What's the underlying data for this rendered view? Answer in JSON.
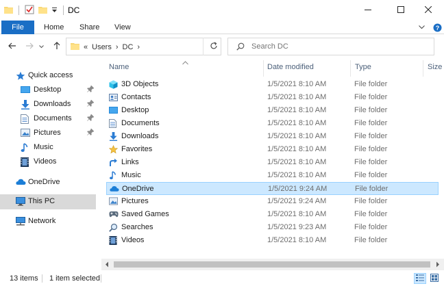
{
  "window": {
    "title": "DC",
    "minimize_icon": "minimize-icon",
    "maximize_icon": "maximize-icon",
    "close_icon": "close-icon"
  },
  "quick_access_toolbar": {
    "icons": [
      "folder-icon",
      "properties-icon",
      "new-folder-icon",
      "customize-dropdown-icon"
    ]
  },
  "ribbon": {
    "tabs": [
      "File",
      "Home",
      "Share",
      "View"
    ],
    "file_tab_color": "#1a6ec5",
    "expand_icon": "chevron-down-icon",
    "help_icon": "help-icon"
  },
  "address_bar": {
    "back_icon": "back-arrow-icon",
    "forward_icon": "forward-arrow-icon",
    "recent_icon": "recent-locations-dropdown-icon",
    "up_icon": "up-arrow-icon",
    "overflow": "«",
    "crumbs": [
      "Users",
      "DC"
    ],
    "separator": "›",
    "dropdown_icon": "chevron-down-icon",
    "refresh_icon": "refresh-icon"
  },
  "search": {
    "placeholder": "Search DC",
    "icon": "search-icon"
  },
  "nav": {
    "quick_access": {
      "label": "Quick access",
      "icon": "star-icon"
    },
    "pinned": [
      {
        "label": "Desktop",
        "icon": "desktop-icon",
        "pinned": true
      },
      {
        "label": "Downloads",
        "icon": "download-icon",
        "pinned": true
      },
      {
        "label": "Documents",
        "icon": "documents-icon",
        "pinned": true
      },
      {
        "label": "Pictures",
        "icon": "pictures-icon",
        "pinned": true
      },
      {
        "label": "Music",
        "icon": "music-icon",
        "pinned": false
      },
      {
        "label": "Videos",
        "icon": "videos-icon",
        "pinned": false
      }
    ],
    "onedrive": {
      "label": "OneDrive",
      "icon": "cloud-icon"
    },
    "this_pc": {
      "label": "This PC",
      "icon": "computer-icon",
      "selected": true
    },
    "network": {
      "label": "Network",
      "icon": "network-icon"
    }
  },
  "columns": {
    "name": "Name",
    "date": "Date modified",
    "type": "Type",
    "size": "Size"
  },
  "files": [
    {
      "name": "3D Objects",
      "date": "1/5/2021 8:10 AM",
      "type": "File folder",
      "icon": "3d-objects-icon"
    },
    {
      "name": "Contacts",
      "date": "1/5/2021 8:10 AM",
      "type": "File folder",
      "icon": "contacts-icon"
    },
    {
      "name": "Desktop",
      "date": "1/5/2021 8:10 AM",
      "type": "File folder",
      "icon": "desktop-icon"
    },
    {
      "name": "Documents",
      "date": "1/5/2021 8:10 AM",
      "type": "File folder",
      "icon": "documents-icon"
    },
    {
      "name": "Downloads",
      "date": "1/5/2021 8:10 AM",
      "type": "File folder",
      "icon": "download-icon"
    },
    {
      "name": "Favorites",
      "date": "1/5/2021 8:10 AM",
      "type": "File folder",
      "icon": "favorites-star-icon"
    },
    {
      "name": "Links",
      "date": "1/5/2021 8:10 AM",
      "type": "File folder",
      "icon": "links-arrow-icon"
    },
    {
      "name": "Music",
      "date": "1/5/2021 8:10 AM",
      "type": "File folder",
      "icon": "music-icon"
    },
    {
      "name": "OneDrive",
      "date": "1/5/2021 9:24 AM",
      "type": "File folder",
      "icon": "cloud-icon",
      "selected": true
    },
    {
      "name": "Pictures",
      "date": "1/5/2021 9:24 AM",
      "type": "File folder",
      "icon": "pictures-icon"
    },
    {
      "name": "Saved Games",
      "date": "1/5/2021 8:10 AM",
      "type": "File folder",
      "icon": "saved-games-icon"
    },
    {
      "name": "Searches",
      "date": "1/5/2021 9:23 AM",
      "type": "File folder",
      "icon": "searches-icon"
    },
    {
      "name": "Videos",
      "date": "1/5/2021 8:10 AM",
      "type": "File folder",
      "icon": "videos-icon"
    }
  ],
  "status": {
    "item_count": "13 items",
    "selection": "1 item selected",
    "details_view_icon": "details-view-icon",
    "large_icons_view_icon": "large-icons-view-icon"
  },
  "colors": {
    "accent": "#1a6ec5",
    "selection_bg": "#cce8ff",
    "selection_border": "#99d1ff",
    "nav_selected_bg": "#d9d9d9",
    "header_text": "#4c607a",
    "secondary_text": "#6d6d6d"
  }
}
